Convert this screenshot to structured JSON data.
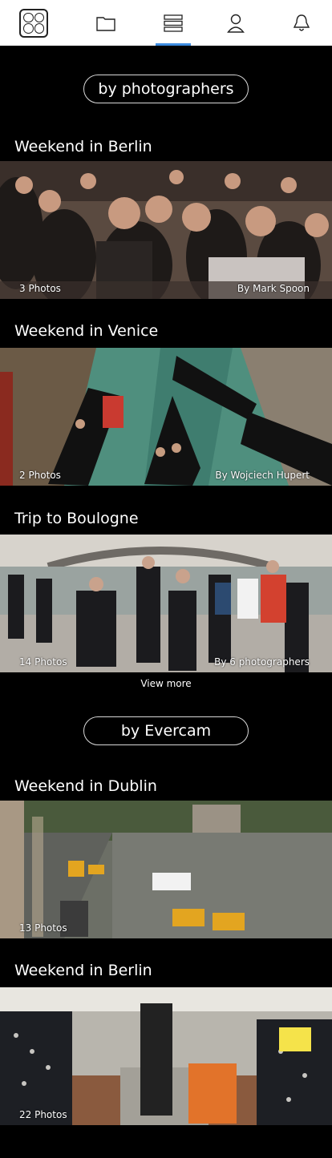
{
  "sections": {
    "photographers_label": "by photographers",
    "evercam_label": "by Evercam"
  },
  "albums": [
    {
      "title": "Weekend in Berlin",
      "count": "3 Photos",
      "author": "By Mark Spoon"
    },
    {
      "title": "Weekend in Venice",
      "count": "2 Photos",
      "author": "By Wojciech Hupert"
    },
    {
      "title": "Trip to Boulogne",
      "count": "14 Photos",
      "author": "By 6 photographers"
    },
    {
      "title": "Weekend in Dublin",
      "count": "13 Photos"
    },
    {
      "title": "Weekend in Berlin",
      "count": "22 Photos"
    }
  ],
  "view_more": "View more",
  "nav": {
    "icons": [
      "app-logo",
      "folder-icon",
      "list-icon",
      "user-icon",
      "bell-icon"
    ],
    "active": "list-icon",
    "accent": "#3d8ce0"
  }
}
